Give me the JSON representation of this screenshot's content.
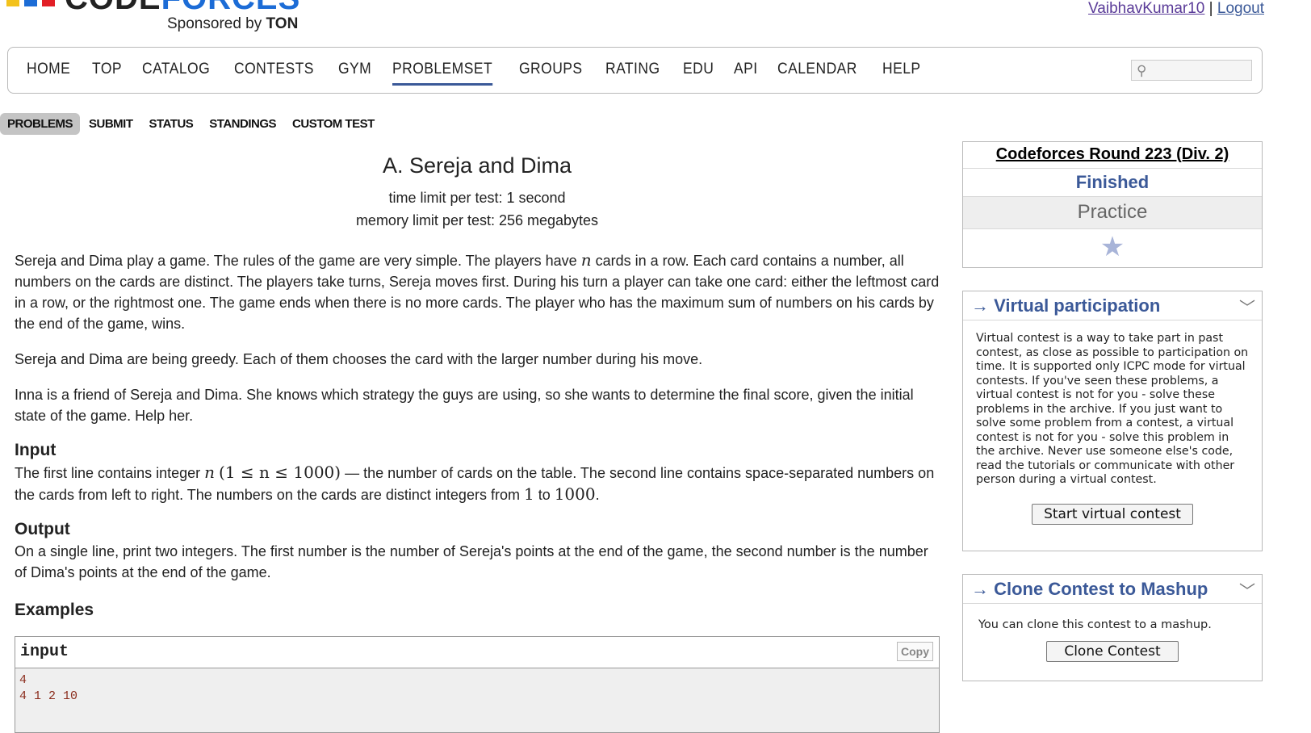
{
  "brand": {
    "word_left": "CODE",
    "word_right": "FORCES",
    "sponsor_prefix": "Sponsored by",
    "sponsor_name": "TON"
  },
  "user": {
    "name": "VaibhavKumar10",
    "separator": "|",
    "logout": "Logout"
  },
  "menu": [
    "HOME",
    "TOP",
    "CATALOG",
    "CONTESTS",
    "GYM",
    "PROBLEMSET",
    "GROUPS",
    "RATING",
    "EDU",
    "API",
    "CALENDAR",
    "HELP"
  ],
  "menu_active": "PROBLEMSET",
  "subtabs": [
    "PROBLEMS",
    "SUBMIT",
    "STATUS",
    "STANDINGS",
    "CUSTOM TEST"
  ],
  "subtab_active": "PROBLEMS",
  "problem": {
    "title": "A. Sereja and Dima",
    "time_limit": "time limit per test: 1 second",
    "memory_limit": "memory limit per test: 256 megabytes",
    "legend_1a": "Sereja and Dima play a game. The rules of the game are very simple. The players have ",
    "var_n": "n",
    "legend_1b": " cards in a row. Each card contains a number, all numbers on the cards are distinct. The players take turns, Sereja moves first. During his turn a player can take one card: either the leftmost card in a row, or the rightmost one. The game ends when there is no more cards. The player who has the maximum sum of numbers on his cards by the end of the game, wins.",
    "legend_2": "Sereja and Dima are being greedy. Each of them chooses the card with the larger number during his move.",
    "legend_3": "Inna is a friend of Sereja and Dima. She knows which strategy the guys are using, so she wants to determine the final score, given the initial state of the game. Help her.",
    "input_title": "Input",
    "input_a": "The first line contains integer ",
    "input_math": "(1 ≤ n ≤ 1000)",
    "input_b": " — the number of cards on the table. The second line contains space-separated numbers on the cards from left to right. The numbers on the cards are distinct integers from ",
    "input_low": "1",
    "input_to": " to ",
    "input_high": "1000",
    "input_end": ".",
    "output_title": "Output",
    "output_text": "On a single line, print two integers. The first number is the number of Sereja's points at the end of the game, the second number is the number of Dima's points at the end of the game.",
    "examples_title": "Examples",
    "sample_head": "input",
    "copy_label": "Copy",
    "sample_input": "4\n4 1 2 10"
  },
  "sidebar": {
    "contest_name": "Codeforces Round 223 (Div. 2)",
    "phase": "Finished",
    "practice": "Practice",
    "virtual": {
      "title": "→ Virtual participation",
      "text": "Virtual contest is a way to take part in past contest, as close as possible to participation on time. It is supported only ICPC mode for virtual contests. If you've seen these problems, a virtual contest is not for you - solve these problems in the archive. If you just want to solve some problem from a contest, a virtual contest is not for you - solve this problem in the archive. Never use someone else's code, read the tutorials or communicate with other person during a virtual contest.",
      "button": "Start virtual contest"
    },
    "clone": {
      "title": "→ Clone Contest to Mashup",
      "text": "You can clone this contest to a mashup.",
      "button": "Clone Contest"
    }
  },
  "icons": {
    "search": "magnifier-icon",
    "star": "star-icon",
    "chevron": "chevron-down-icon"
  },
  "colors": {
    "brand_blue": "#1c6cd6",
    "link_blue": "#3b5998",
    "sample_text": "#8b2d1d"
  }
}
